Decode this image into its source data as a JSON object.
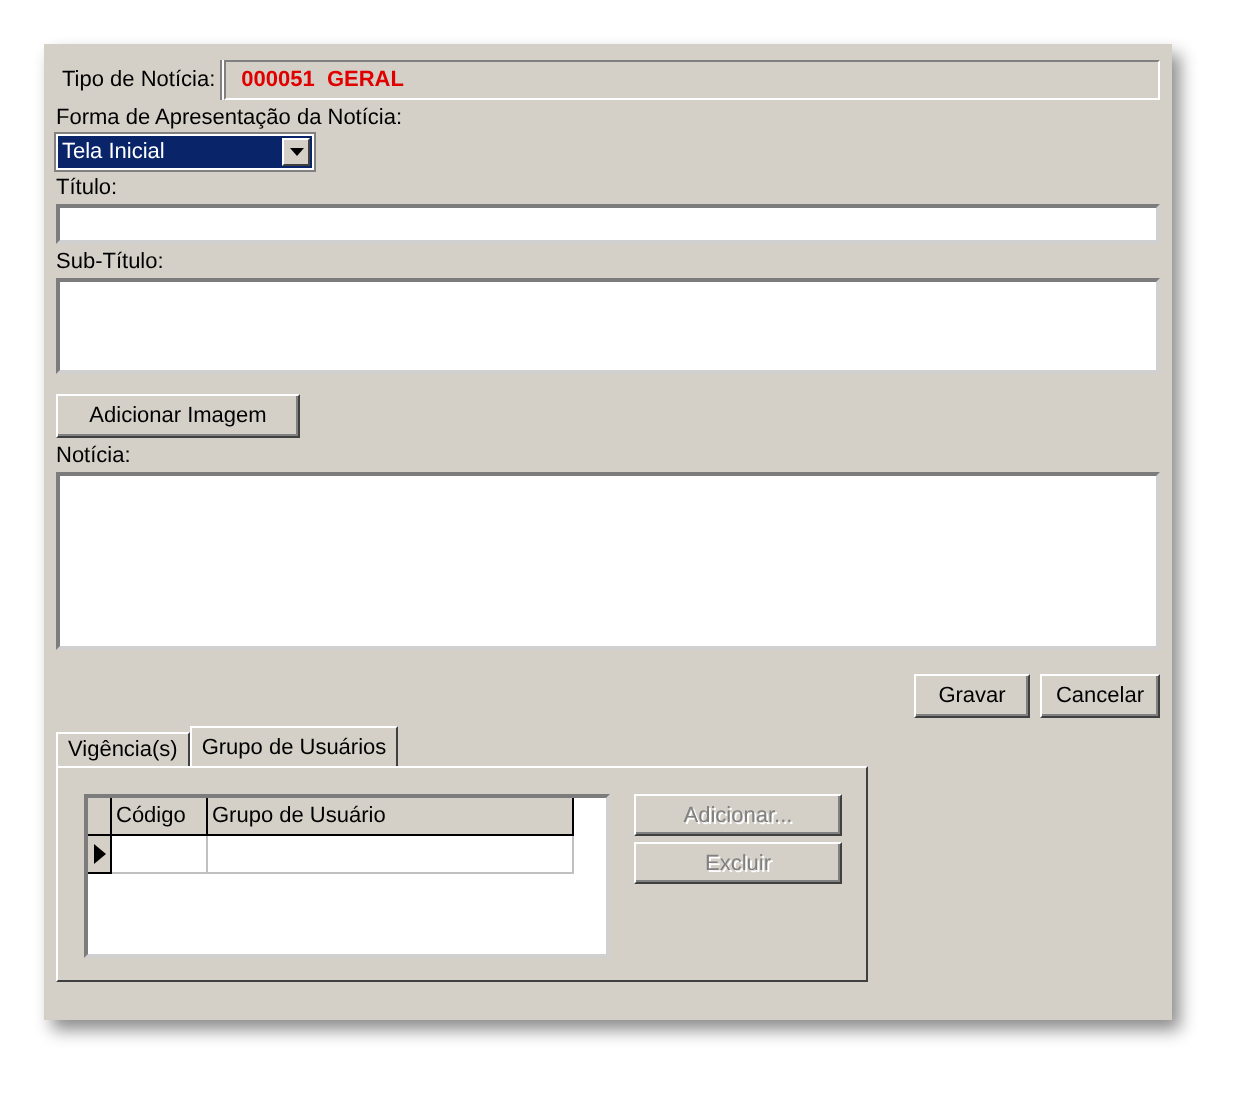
{
  "tipo": {
    "label": "Tipo de Notícia:",
    "value": "000051  GERAL"
  },
  "forma": {
    "label": "Forma de Apresentação da Notícia:",
    "value": "Tela Inicial"
  },
  "titulo": {
    "label": "Título:"
  },
  "subtitulo": {
    "label": "Sub-Título:"
  },
  "image_button": "Adicionar Imagem",
  "noticia": {
    "label": "Notícia:"
  },
  "buttons": [
    "Gravar",
    "Cancelar"
  ],
  "tabs": [
    {
      "label": "Vigência(s)",
      "selected": false
    },
    {
      "label": "Grupo de Usuários",
      "selected": true
    }
  ],
  "table": {
    "columns": [
      "Código",
      "Grupo de Usuário"
    ],
    "rows": [
      {
        "current": true
      }
    ]
  },
  "actions": [
    {
      "label": "Adicionar...",
      "disabled": true
    },
    {
      "label": "Excluir",
      "disabled": true
    }
  ]
}
